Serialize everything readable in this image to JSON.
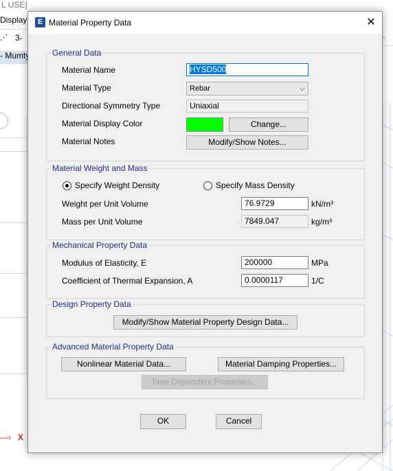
{
  "background": {
    "menu_fragment": "L USE]",
    "display_menu": "Display",
    "toolbar_fragment": "3-",
    "tab_fragment": "- Mumty",
    "axis_label": "X",
    "axis_color": "#e02020"
  },
  "dialog": {
    "title": "Material Property Data",
    "app_icon": "E",
    "close_glyph": "✕",
    "general": {
      "title": "General Data",
      "material_name_label": "Material Name",
      "material_name_value": "HYSD500",
      "material_type_label": "Material Type",
      "material_type_value": "Rebar",
      "symmetry_label": "Directional Symmetry Type",
      "symmetry_value": "Uniaxial",
      "display_color_label": "Material Display Color",
      "display_color": "#00ff00",
      "change_button": "Change...",
      "notes_label": "Material Notes",
      "notes_button": "Modify/Show Notes..."
    },
    "weight": {
      "title": "Material Weight and Mass",
      "weight_density_option": "Specify Weight Density",
      "mass_density_option": "Specify Mass Density",
      "selected_option": "weight",
      "weight_label": "Weight per Unit Volume",
      "weight_value": "76.9729",
      "weight_unit": "kN/m³",
      "mass_label": "Mass per Unit Volume",
      "mass_value": "7849.047",
      "mass_unit": "kg/m³"
    },
    "mechanical": {
      "title": "Mechanical Property Data",
      "modulus_label": "Modulus of Elasticity,  E",
      "modulus_value": "200000",
      "modulus_unit": "MPa",
      "thermal_label": "Coefficient of Thermal Expansion,  A",
      "thermal_value": "0.0000117",
      "thermal_unit": "1/C"
    },
    "design": {
      "title": "Design Property Data",
      "button": "Modify/Show Material Property Design Data..."
    },
    "advanced": {
      "title": "Advanced Material Property Data",
      "nonlinear_button": "Nonlinear Material Data...",
      "damping_button": "Material Damping Properties...",
      "time_button": "Time Dependent Properties..."
    },
    "ok_button": "OK",
    "cancel_button": "Cancel"
  }
}
